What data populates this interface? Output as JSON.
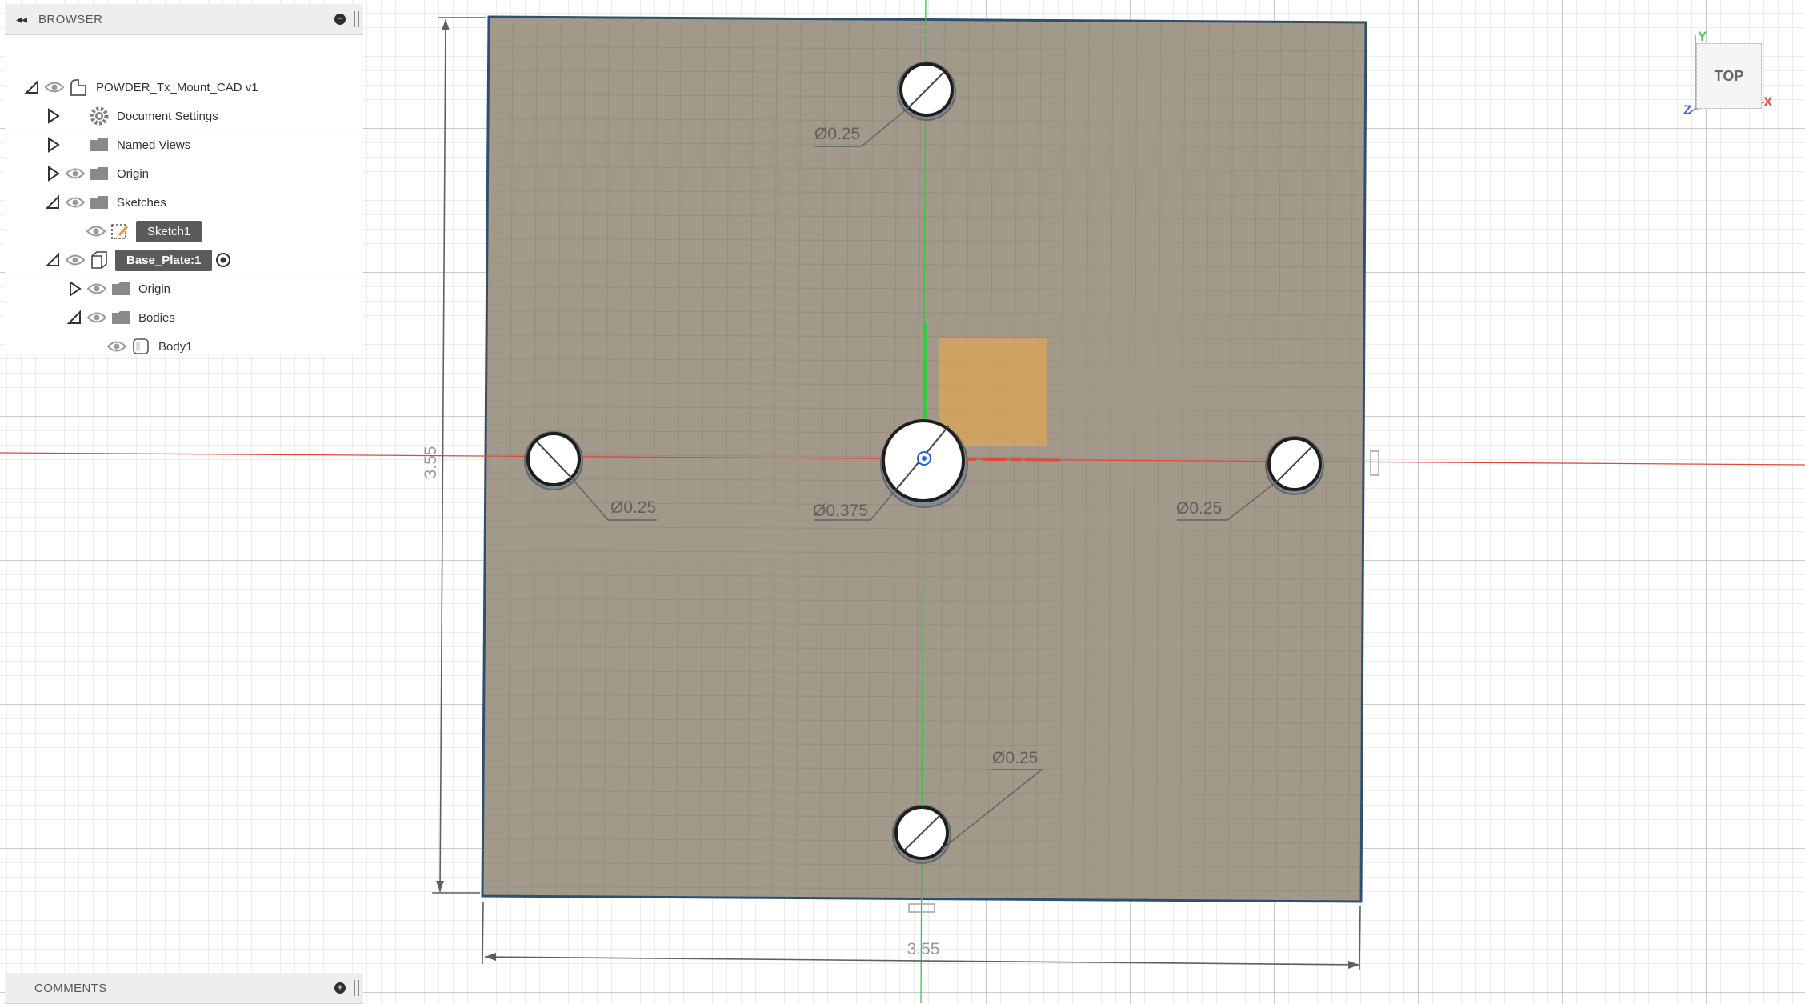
{
  "browser": {
    "title": "BROWSER",
    "items": [
      {
        "label": "POWDER_Tx_Mount_CAD v1",
        "icon": "document-icon",
        "expander": "expanded",
        "visible": true
      },
      {
        "label": "Document Settings",
        "icon": "gear-icon",
        "expander": "collapsed",
        "visible": false
      },
      {
        "label": "Named Views",
        "icon": "folder-icon",
        "expander": "collapsed",
        "visible": false
      },
      {
        "label": "Origin",
        "icon": "folder-icon",
        "expander": "collapsed",
        "visible": true
      },
      {
        "label": "Sketches",
        "icon": "folder-icon",
        "expander": "expanded",
        "visible": true
      },
      {
        "label": "Sketch1",
        "icon": "sketch-icon",
        "expander": "none",
        "visible": true,
        "selected": true
      },
      {
        "label": "Base_Plate:1",
        "icon": "component-icon",
        "expander": "expanded",
        "visible": true,
        "selected": true,
        "active": true
      },
      {
        "label": "Origin",
        "icon": "folder-icon",
        "expander": "collapsed",
        "visible": true
      },
      {
        "label": "Bodies",
        "icon": "folder-icon",
        "expander": "expanded",
        "visible": true
      },
      {
        "label": "Body1",
        "icon": "body-icon",
        "expander": "none",
        "visible": true
      }
    ]
  },
  "comments": {
    "title": "COMMENTS"
  },
  "viewcube": {
    "face": "TOP",
    "axes": {
      "x": "X",
      "y": "Y",
      "z": "Z"
    }
  },
  "sketch": {
    "width_dimension": "3.55",
    "height_dimension": "3.55",
    "hole_dimensions": {
      "top": "Ø0.25",
      "left": "Ø0.25",
      "center": "Ø0.375",
      "right": "Ø0.25",
      "bottom": "Ø0.25"
    }
  },
  "colors": {
    "plate": "#9e9585",
    "highlight": "#e8a84a",
    "x_axis": "#e0483c",
    "y_axis": "#3bc04a",
    "dimension": "#5f5f5f"
  }
}
